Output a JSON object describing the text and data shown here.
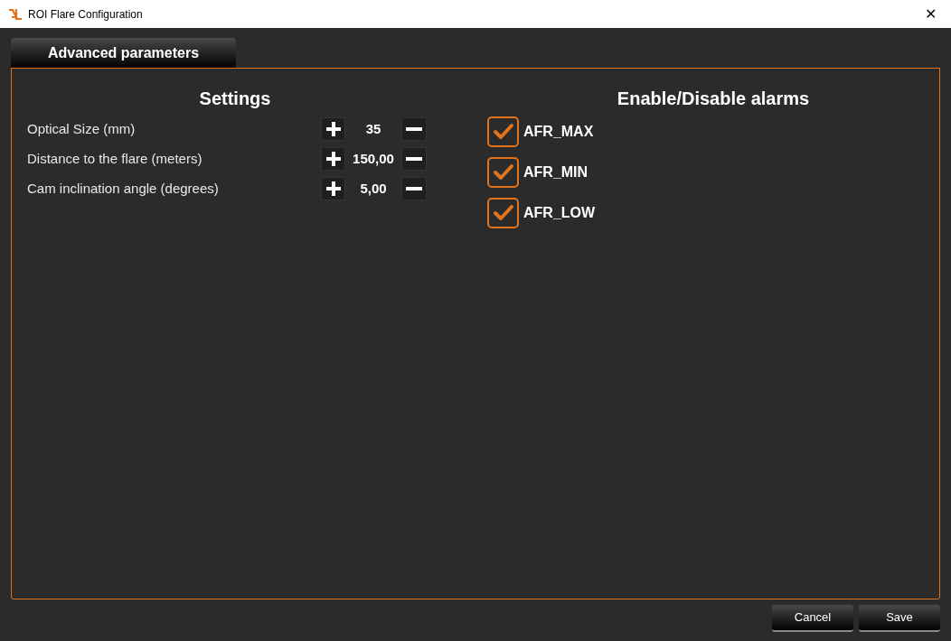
{
  "window": {
    "title": "ROI Flare Configuration",
    "close": "✕"
  },
  "tabs": [
    {
      "label": "Advanced parameters",
      "selected": true
    }
  ],
  "settings": {
    "title": "Settings",
    "rows": [
      {
        "label": "Optical Size (mm)",
        "value": "35"
      },
      {
        "label": "Distance to the flare (meters)",
        "value": "150,00"
      },
      {
        "label": "Cam inclination angle (degrees)",
        "value": "5,00"
      }
    ]
  },
  "alarms": {
    "title": "Enable/Disable alarms",
    "items": [
      {
        "label": "AFR_MAX",
        "checked": true
      },
      {
        "label": "AFR_MIN",
        "checked": true
      },
      {
        "label": "AFR_LOW",
        "checked": true
      }
    ]
  },
  "buttons": [
    "Cancel",
    "Save"
  ]
}
